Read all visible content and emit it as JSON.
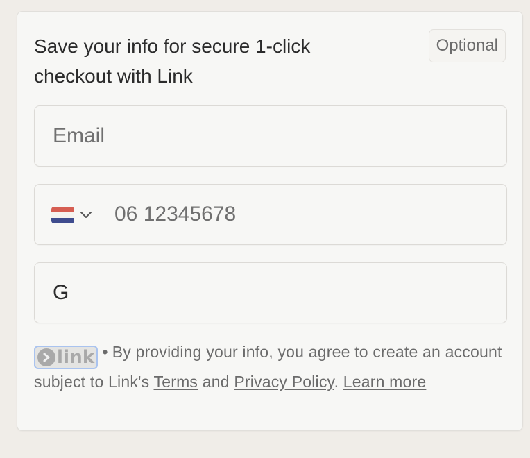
{
  "header": {
    "title": "Save your info for secure 1-click checkout with Link",
    "badge": "Optional"
  },
  "fields": {
    "email": {
      "placeholder": "Email",
      "value": ""
    },
    "phone": {
      "placeholder": "06 12345678",
      "value": "",
      "country_flag_colors": [
        "#d65e52",
        "#f5f3ef",
        "#3f4c8e"
      ]
    },
    "name": {
      "value": "G"
    }
  },
  "footer": {
    "logo_text": "link",
    "separator": "•",
    "text_1": "By providing your info, you agree to create an account subject to Link's",
    "terms_link": "Terms",
    "text_2": "and",
    "privacy_link": "Privacy Policy",
    "text_3": ".",
    "learn_more_link": "Learn more"
  },
  "colors": {
    "background": "#f0ede8",
    "card": "#f7f7f5",
    "logo_focus_ring": "#a9c3ef"
  }
}
